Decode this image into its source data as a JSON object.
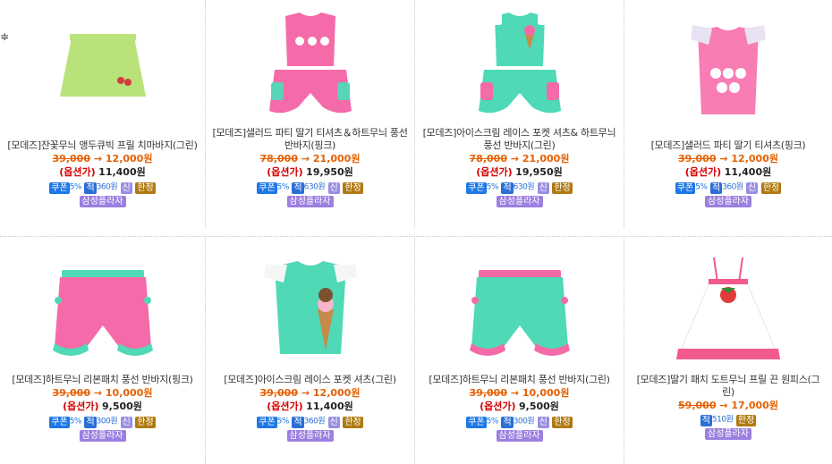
{
  "edge_fragment": "≑",
  "labels": {
    "option_price": "(옵션가)",
    "arrow": "→",
    "coupon": "쿠폰",
    "point": "적",
    "new": "신",
    "limited": "한정",
    "card": "삼성플라자"
  },
  "products": [
    {
      "name": "[모데즈]잔꽃무늬 앵두큐빅 프릴 치마바지(그린)",
      "old_price": "39,000",
      "new_price": "12,000원",
      "option_price": "11,400원",
      "coupon_pct": "5%",
      "points": "360원",
      "has_new": true,
      "has_limited": true,
      "colors": {
        "main": "#b9e27a",
        "trim": "#ffffff",
        "accent": "#d33c3c"
      }
    },
    {
      "name": "[모데즈]샐러드 파티 딸기 티셔츠＆하트무늬 풍선 반바지(핑크)",
      "old_price": "78,000",
      "new_price": "21,000원",
      "option_price": "19,950원",
      "coupon_pct": "5%",
      "points": "630원",
      "has_new": true,
      "has_limited": true,
      "colors": {
        "main": "#f56aa8",
        "trim": "#58d4b8",
        "accent": "#ffffff"
      }
    },
    {
      "name": "[모데즈]아이스크림 레이스 포켓 셔츠& 하트무늬 풍선 반바지(그린)",
      "old_price": "78,000",
      "new_price": "21,000원",
      "option_price": "19,950원",
      "coupon_pct": "5%",
      "points": "630원",
      "has_new": true,
      "has_limited": true,
      "colors": {
        "main": "#4fd9b6",
        "trim": "#f56aa8",
        "accent": "#ffffff"
      }
    },
    {
      "name": "[모데즈]샐러드 파티 딸기 티셔츠(핑크)",
      "old_price": "39,000",
      "new_price": "12,000원",
      "option_price": "11,400원",
      "coupon_pct": "5%",
      "points": "360원",
      "has_new": true,
      "has_limited": true,
      "colors": {
        "main": "#f77db4",
        "trim": "#e8e2f2",
        "accent": "#ffffff"
      }
    },
    {
      "name": "[모데즈]하트무늬 리본패치 풍선 반바지(핑크)",
      "old_price": "39,000",
      "new_price": "10,000원",
      "option_price": "9,500원",
      "coupon_pct": "5%",
      "points": "300원",
      "has_new": true,
      "has_limited": true,
      "colors": {
        "main": "#f56aa8",
        "trim": "#4fd9b6",
        "accent": "#ffffff"
      }
    },
    {
      "name": "[모데즈]아이스크림 레이스 포켓 셔츠(그린)",
      "old_price": "39,000",
      "new_price": "12,000원",
      "option_price": "11,400원",
      "coupon_pct": "5%",
      "points": "360원",
      "has_new": true,
      "has_limited": true,
      "colors": {
        "main": "#4fd9b6",
        "trim": "#f5f5f5",
        "accent": "#7a5230"
      }
    },
    {
      "name": "[모데즈]하트무늬 리본패치 풍선 반바지(그린)",
      "old_price": "39,000",
      "new_price": "10,000원",
      "option_price": "9,500원",
      "coupon_pct": "5%",
      "points": "300원",
      "has_new": true,
      "has_limited": true,
      "colors": {
        "main": "#4fd9b6",
        "trim": "#f56aa8",
        "accent": "#ffffff"
      }
    },
    {
      "name": "[모데즈]딸기 패치 도트무늬 프릴 끈 원피스(그린)",
      "old_price": "59,000",
      "new_price": "17,000원",
      "option_price": null,
      "coupon_pct": null,
      "points": "510원",
      "has_new": false,
      "has_limited": true,
      "colors": {
        "main": "#ffffff",
        "trim": "#f25a8c",
        "accent": "#2f8f3a"
      }
    }
  ]
}
